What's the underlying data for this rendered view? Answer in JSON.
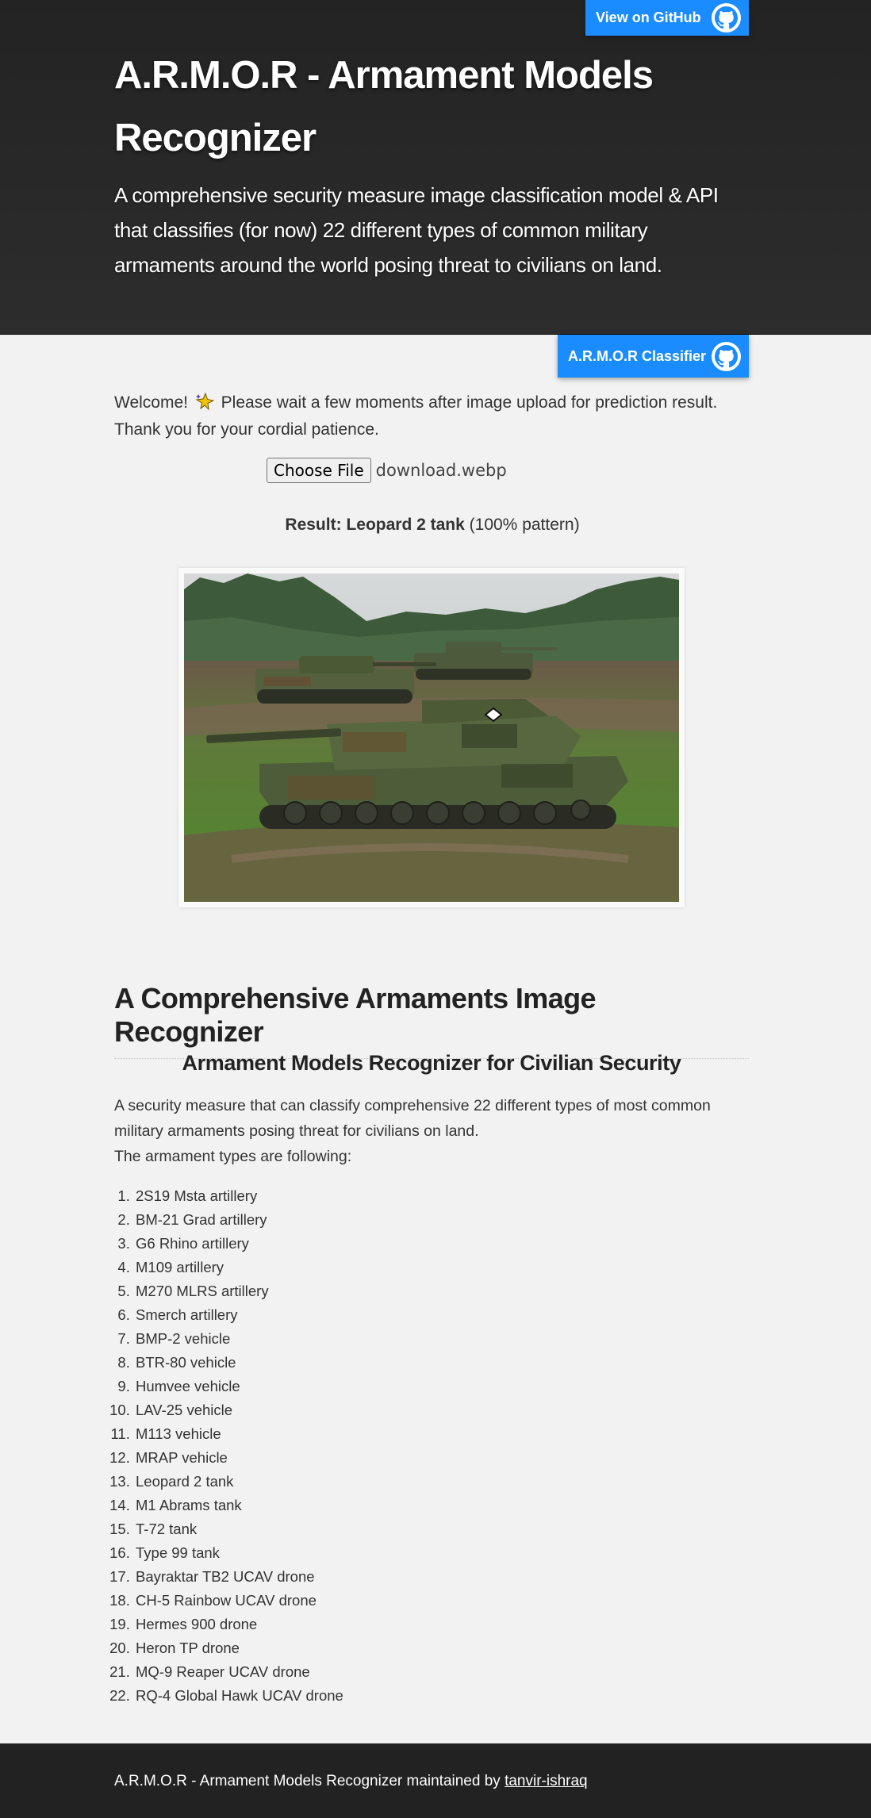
{
  "header": {
    "github_button_label": "View on GitHub",
    "title": "A.R.M.O.R - Armament Models Recognizer",
    "subtitle": "A comprehensive security measure image classification model & API that classifies (for now) 22 different types of common military armaments around the world posing threat to civilians on land."
  },
  "classifier_button_label": "A.R.M.O.R Classifier",
  "upload": {
    "welcome_before": "Welcome!",
    "welcome_after": "Please wait a few moments after image upload for prediction result. Thank you for your cordial patience.",
    "choose_file_label": "Choose File",
    "file_name": "download.webp",
    "result_label": "Result:",
    "result_value": "Leopard 2 tank",
    "result_confidence": "(100% pattern)"
  },
  "info": {
    "heading": "A Comprehensive Armaments Image Recognizer",
    "subheading": "Armament Models Recognizer for Civilian Security",
    "description": "A security measure that can classify comprehensive 22 different types of most common military armaments posing threat for civilians on land.",
    "types_intro": "The armament types are following:",
    "armament_types": [
      "2S19 Msta artillery",
      "BM-21 Grad artillery",
      "G6 Rhino artillery",
      "M109 artillery",
      "M270 MLRS artillery",
      "Smerch artillery",
      "BMP-2 vehicle",
      "BTR-80 vehicle",
      "Humvee vehicle",
      "LAV-25 vehicle",
      "M113 vehicle",
      "MRAP vehicle",
      "Leopard 2 tank",
      "M1 Abrams tank",
      "T-72 tank",
      "Type 99 tank",
      "Bayraktar TB2 UCAV drone",
      "CH-5 Rainbow UCAV drone",
      "Hermes 900 drone",
      "Heron TP drone",
      "MQ-9 Reaper UCAV drone",
      "RQ-4 Global Hawk UCAV drone"
    ]
  },
  "footer": {
    "text": "A.R.M.O.R - Armament Models Recognizer maintained by",
    "link_label": "tanvir-ishraq"
  },
  "colors": {
    "header_bg": "#2b2b2b",
    "button_blue": "#1a8cff",
    "page_bg": "#f2f2f2",
    "footer_bg": "#222222"
  },
  "icons": [
    "github-icon",
    "sparkle-star-icon"
  ]
}
